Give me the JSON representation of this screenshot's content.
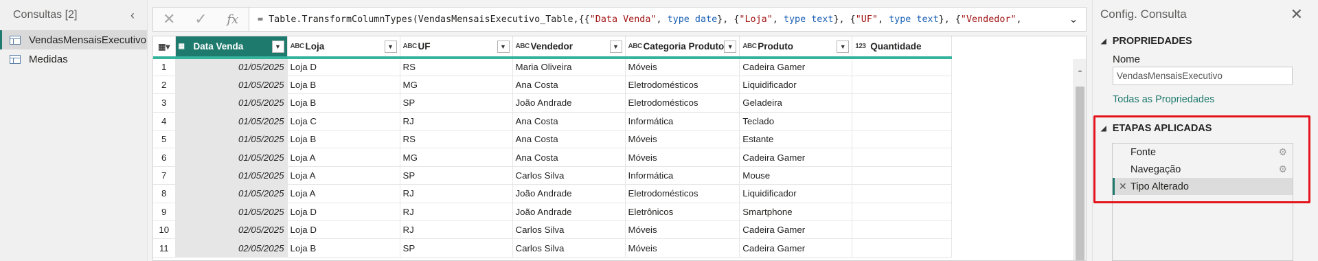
{
  "queries": {
    "title": "Consultas [2]",
    "collapse_icon": "‹",
    "items": [
      {
        "label": "VendasMensaisExecutivo",
        "selected": true
      },
      {
        "label": "Medidas",
        "selected": false
      }
    ]
  },
  "formula_bar": {
    "cancel_icon": "✕",
    "confirm_icon": "✓",
    "fx_label": "fx",
    "expand_icon": "⌄",
    "formula_parts": [
      {
        "t": "= Table.TransformColumnTypes(VendasMensaisExecutivo_Table,{{",
        "c": ""
      },
      {
        "t": "\"Data Venda\"",
        "c": "str"
      },
      {
        "t": ", ",
        "c": ""
      },
      {
        "t": "type date",
        "c": "kw"
      },
      {
        "t": "}, {",
        "c": ""
      },
      {
        "t": "\"Loja\"",
        "c": "str"
      },
      {
        "t": ", ",
        "c": ""
      },
      {
        "t": "type text",
        "c": "kw"
      },
      {
        "t": "}, {",
        "c": ""
      },
      {
        "t": "\"UF\"",
        "c": "str"
      },
      {
        "t": ", ",
        "c": ""
      },
      {
        "t": "type text",
        "c": "kw"
      },
      {
        "t": "}, {",
        "c": ""
      },
      {
        "t": "\"Vendedor\"",
        "c": "str"
      },
      {
        "t": ",",
        "c": ""
      }
    ]
  },
  "grid": {
    "columns": [
      {
        "label": "Data Venda",
        "type_icon": "▦",
        "selected": true
      },
      {
        "label": "Loja",
        "type_icon": "ABC",
        "selected": false
      },
      {
        "label": "UF",
        "type_icon": "ABC",
        "selected": false
      },
      {
        "label": "Vendedor",
        "type_icon": "ABC",
        "selected": false
      },
      {
        "label": "Categoria Produto",
        "type_icon": "ABC",
        "selected": false
      },
      {
        "label": "Produto",
        "type_icon": "ABC",
        "selected": false
      },
      {
        "label": "Quantidade",
        "type_icon": "123",
        "selected": false
      }
    ],
    "rows": [
      [
        "1",
        "01/05/2025",
        "Loja D",
        "RS",
        "Maria Oliveira",
        "Móveis",
        "Cadeira Gamer",
        ""
      ],
      [
        "2",
        "01/05/2025",
        "Loja B",
        "MG",
        "Ana Costa",
        "Eletrodomésticos",
        "Liquidificador",
        ""
      ],
      [
        "3",
        "01/05/2025",
        "Loja B",
        "SP",
        "João Andrade",
        "Eletrodomésticos",
        "Geladeira",
        ""
      ],
      [
        "4",
        "01/05/2025",
        "Loja C",
        "RJ",
        "Ana Costa",
        "Informática",
        "Teclado",
        ""
      ],
      [
        "5",
        "01/05/2025",
        "Loja B",
        "RS",
        "Ana Costa",
        "Móveis",
        "Estante",
        ""
      ],
      [
        "6",
        "01/05/2025",
        "Loja A",
        "MG",
        "Ana Costa",
        "Móveis",
        "Cadeira Gamer",
        ""
      ],
      [
        "7",
        "01/05/2025",
        "Loja A",
        "SP",
        "Carlos Silva",
        "Informática",
        "Mouse",
        ""
      ],
      [
        "8",
        "01/05/2025",
        "Loja A",
        "RJ",
        "João Andrade",
        "Eletrodomésticos",
        "Liquidificador",
        ""
      ],
      [
        "9",
        "01/05/2025",
        "Loja D",
        "RJ",
        "João Andrade",
        "Eletrônicos",
        "Smartphone",
        ""
      ],
      [
        "10",
        "02/05/2025",
        "Loja D",
        "RJ",
        "Carlos Silva",
        "Móveis",
        "Cadeira Gamer",
        ""
      ],
      [
        "11",
        "02/05/2025",
        "Loja B",
        "SP",
        "Carlos Silva",
        "Móveis",
        "Cadeira Gamer",
        ""
      ]
    ]
  },
  "settings": {
    "title": "Config. Consulta",
    "close_icon": "✕",
    "properties_heading": "PROPRIEDADES",
    "name_label": "Nome",
    "name_value": "VendasMensaisExecutivo",
    "all_properties_link": "Todas as Propriedades",
    "steps_heading": "ETAPAS APLICADAS",
    "steps": [
      {
        "label": "Fonte",
        "has_gear": true,
        "selected": false
      },
      {
        "label": "Navegação",
        "has_gear": true,
        "selected": false
      },
      {
        "label": "Tipo Alterado",
        "has_gear": false,
        "selected": true
      }
    ],
    "highlight_color": "#e3121b",
    "accent_color": "#1f7a6e"
  }
}
